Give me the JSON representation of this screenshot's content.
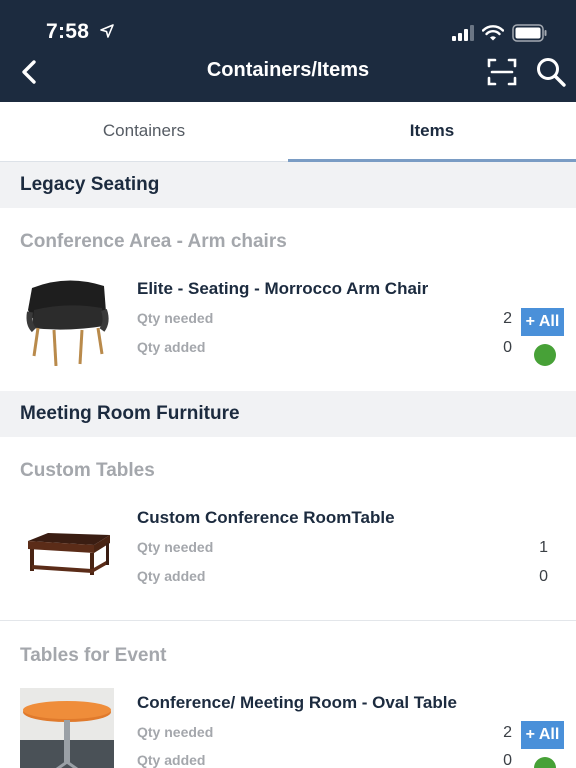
{
  "status_bar": {
    "time": "7:58"
  },
  "nav": {
    "title": "Containers/Items"
  },
  "tabs": [
    {
      "label": "Containers",
      "selected": false
    },
    {
      "label": "Items",
      "selected": true
    }
  ],
  "sections": [
    {
      "title": "Legacy Seating",
      "groups": [
        {
          "label": "Conference Area - Arm chairs",
          "items": [
            {
              "name": "Elite - Seating - Morrocco Arm Chair",
              "qty_needed_label": "Qty needed",
              "qty_needed": "2",
              "qty_added_label": "Qty added",
              "qty_added": "0",
              "add_all_label": "+ All",
              "status_color": "#47a137"
            }
          ]
        }
      ]
    },
    {
      "title": "Meeting Room Furniture",
      "groups": [
        {
          "label": "Custom Tables",
          "items": [
            {
              "name": "Custom Conference RoomTable",
              "qty_needed_label": "Qty needed",
              "qty_needed": "1",
              "qty_added_label": "Qty added",
              "qty_added": "0"
            }
          ]
        },
        {
          "label": "Tables for Event",
          "items": [
            {
              "name": "Conference/ Meeting Room - Oval Table",
              "qty_needed_label": "Qty needed",
              "qty_needed": "2",
              "qty_added_label": "Qty added",
              "qty_added": "0",
              "add_all_label": "+ All",
              "status_color": "#47a137"
            }
          ]
        }
      ]
    }
  ],
  "colors": {
    "header_bg": "#1c2b3f",
    "accent": "#4a90d9",
    "tab_underline": "#7a9cc4",
    "status_green": "#47a137"
  }
}
